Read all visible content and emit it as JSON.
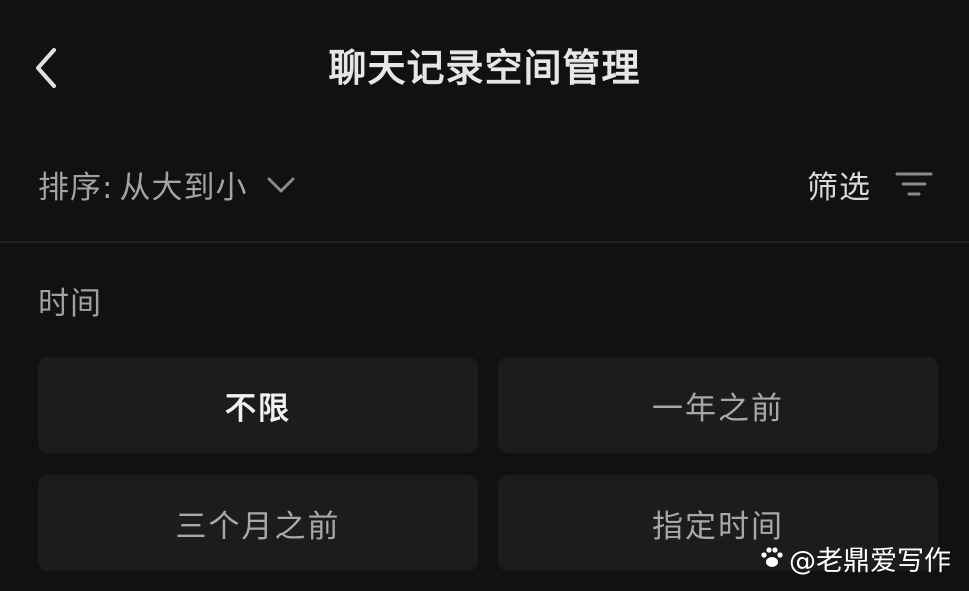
{
  "header": {
    "back_icon": "chevron-left-icon",
    "title": "聊天记录空间管理"
  },
  "toolbar": {
    "sort_prefix": "排序:",
    "sort_value": "从大到小",
    "sort_icon": "chevron-down-icon",
    "filter_label": "筛选",
    "filter_icon": "filter-icon"
  },
  "time_filter": {
    "label": "时间",
    "options": [
      {
        "label": "不限",
        "selected": true
      },
      {
        "label": "一年之前",
        "selected": false
      },
      {
        "label": "三个月之前",
        "selected": false
      },
      {
        "label": "指定时间",
        "selected": false
      }
    ]
  },
  "watermark": {
    "icon": "paw-icon",
    "text": "@老鼎爱写作"
  },
  "colors": {
    "background": "#111111",
    "card": "#1c1c1c",
    "title_text": "#e6e6e6",
    "secondary_text": "#a3a3a3"
  }
}
